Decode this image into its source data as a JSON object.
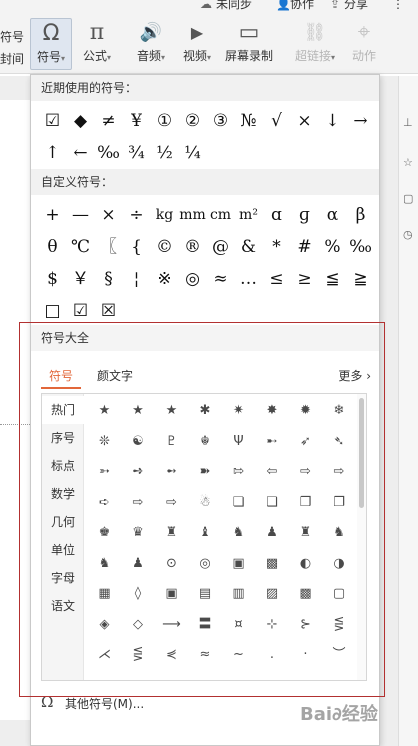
{
  "ribbon": {
    "top_items": [
      "未同步",
      "协作",
      "分享",
      "⋮"
    ],
    "left_clip_1": "符号",
    "left_clip_2": "封间",
    "buttons": [
      {
        "label": "符号",
        "caret": "▾",
        "icon": "omega-icon",
        "glyph": "Ω"
      },
      {
        "label": "公式",
        "caret": "▾",
        "icon": "pi-icon",
        "glyph": "π"
      },
      {
        "label": "音频",
        "caret": "▾",
        "icon": "speaker-icon",
        "glyph": "🔊"
      },
      {
        "label": "视频",
        "caret": "▾",
        "icon": "video-icon",
        "glyph": "▶"
      },
      {
        "label": "屏幕录制",
        "caret": "",
        "icon": "screen-record-icon",
        "glyph": "▭"
      },
      {
        "label": "超链接",
        "caret": "▾",
        "icon": "link-icon",
        "glyph": "⛓"
      },
      {
        "label": "动作",
        "caret": "",
        "icon": "mouse-icon",
        "glyph": "⌖"
      }
    ]
  },
  "popup": {
    "recent_title": "近期使用的符号：",
    "recent_rows": [
      [
        "☑",
        "◆",
        "≠",
        "¥",
        "①",
        "②",
        "③",
        "№",
        "√",
        "×",
        "↓",
        "→"
      ],
      [
        "↑",
        "←",
        "‰",
        "¾",
        "½",
        "¼"
      ]
    ],
    "custom_title": "自定义符号：",
    "custom_rows": [
      [
        "+",
        "—",
        "×",
        "÷",
        "kg",
        "mm",
        "cm",
        "m²",
        "ɑ",
        "ɡ",
        "α",
        "β"
      ],
      [
        "θ",
        "℃",
        "〖",
        "{",
        "©",
        "®",
        "@",
        "&",
        "*",
        "#",
        "%",
        "‰"
      ],
      [
        "$",
        "￥",
        "§",
        "¦",
        "※",
        "◎",
        "≈",
        "…",
        "≤",
        "≥",
        "≦",
        "≧"
      ],
      [
        "□",
        "☑",
        "☒"
      ]
    ],
    "full_title": "符号大全",
    "tabs": [
      "符号",
      "颜文字"
    ],
    "more_label": "更多 ›",
    "categories": [
      "热门",
      "序号",
      "标点",
      "数学",
      "几何",
      "单位",
      "字母",
      "语文"
    ],
    "symbol_rows": [
      [
        "★",
        "★",
        "★",
        "✱",
        "✷",
        "✸",
        "✹",
        "❄"
      ],
      [
        "❊",
        "☯",
        "♇",
        "☬",
        "Ψ",
        "➸",
        "➶",
        "➴"
      ],
      [
        "➳",
        "➺",
        "➻",
        "➽",
        "⇰",
        "⇦",
        "⇨",
        "⇨"
      ],
      [
        "➪",
        "⇨",
        "⇨",
        "☃",
        "❏",
        "❑",
        "❒",
        "❐"
      ],
      [
        "♚",
        "♛",
        "♜",
        "♝",
        "♞",
        "♟",
        "♜",
        "♞"
      ],
      [
        "♞",
        "♟",
        "⊙",
        "◎",
        "▣",
        "▩",
        "◐",
        "◑"
      ],
      [
        "▦",
        "◊",
        "▣",
        "▤",
        "▥",
        "▨",
        "▩",
        "▢"
      ],
      [
        "◈",
        "◇",
        "⟶",
        "〓",
        "¤",
        "⊹",
        "⊱",
        "⋚"
      ],
      [
        "⋌",
        "⋚",
        "⋞",
        "≈",
        "~",
        ".",
        "·",
        "︶"
      ]
    ],
    "other_icon": "Ω",
    "other_label": "其他符号(M)..."
  },
  "watermark": "Bai∂经验"
}
